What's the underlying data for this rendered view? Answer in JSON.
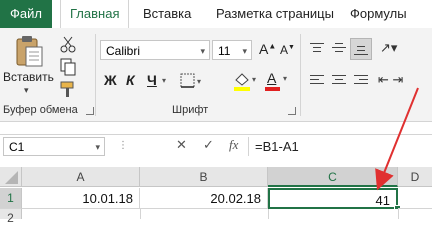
{
  "tabs": {
    "file": "Файл",
    "home": "Главная",
    "insert": "Вставка",
    "layout": "Разметка страницы",
    "formulas": "Формулы"
  },
  "clipboard": {
    "paste": "Вставить",
    "group_label": "Буфер обмена"
  },
  "font": {
    "name": "Calibri",
    "size": "11",
    "group_label": "Шрифт",
    "bold": "Ж",
    "italic": "К",
    "underline": "Ч",
    "grow": "A",
    "shrink": "A",
    "color_letter": "A"
  },
  "formula_bar": {
    "name_box": "C1",
    "cancel": "✕",
    "enter": "✓",
    "fx": "fx",
    "formula": "=B1-A1"
  },
  "grid": {
    "columns": [
      "A",
      "B",
      "C",
      "D"
    ],
    "rows": [
      "1",
      "2"
    ],
    "cells": {
      "A1": "10.01.18",
      "B1": "20.02.18",
      "C1": "41"
    }
  },
  "colors": {
    "accent": "#217346",
    "arrow": "#e03030",
    "highlight": "#ffff00",
    "font_color": "#e02020"
  }
}
